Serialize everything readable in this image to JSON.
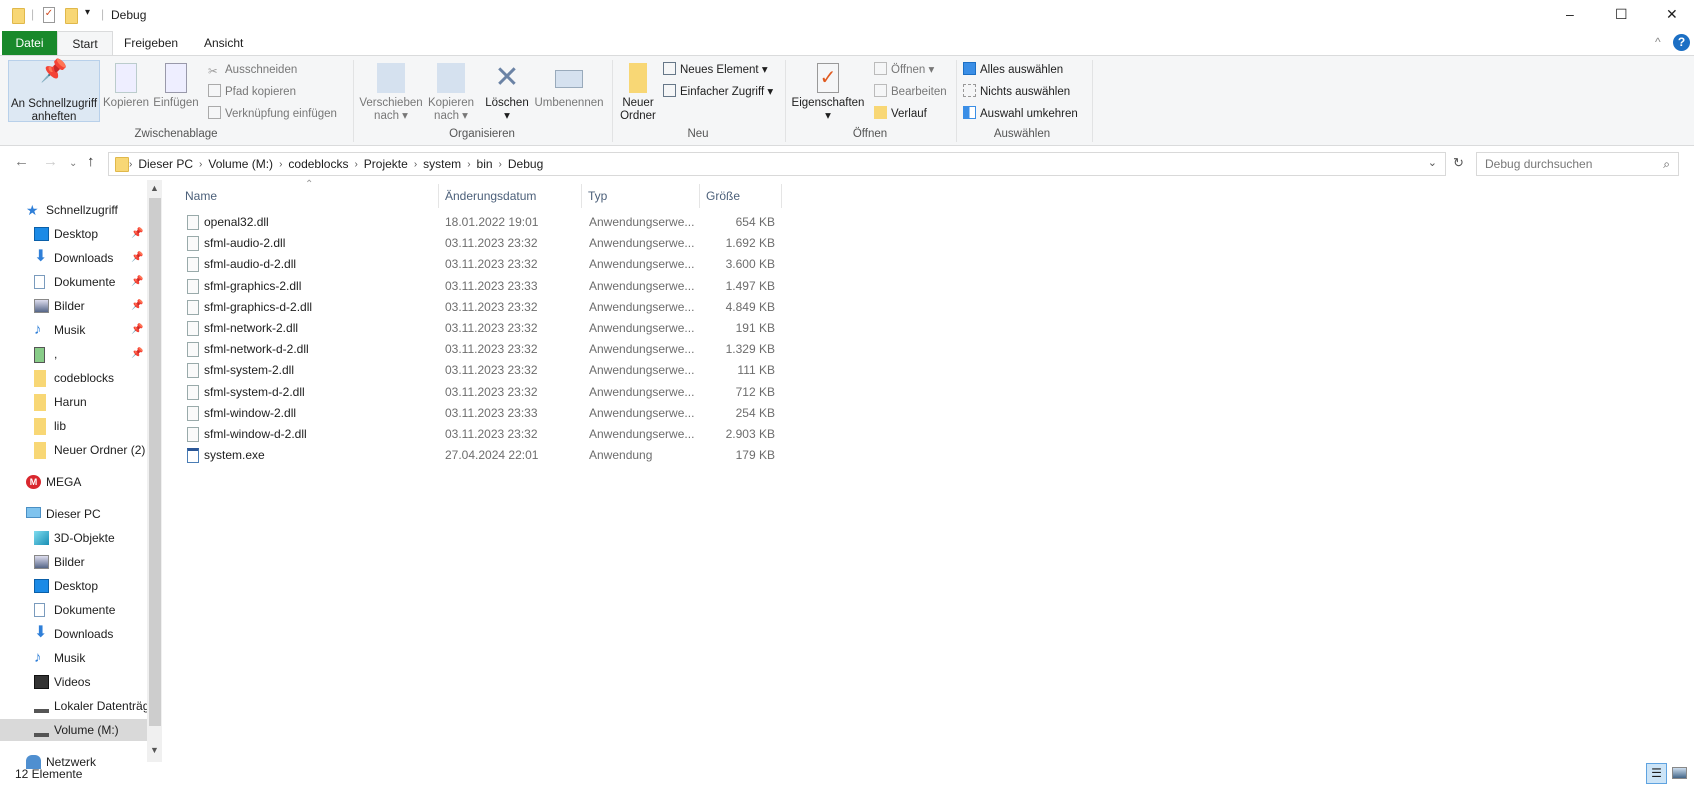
{
  "window": {
    "title": "Debug",
    "minimize": "–",
    "maximize": "☐",
    "close": "✕",
    "help": "?",
    "collapse": "^"
  },
  "tabs": [
    "Datei",
    "Start",
    "Freigeben",
    "Ansicht"
  ],
  "ribbon": {
    "pin": "An Schnellzugriff",
    "pin2": "anheften",
    "copy": "Kopieren",
    "paste": "Einfügen",
    "cut": "Ausschneiden",
    "copy_path": "Pfad kopieren",
    "paste_link": "Verknüpfung einfügen",
    "g_clipboard": "Zwischenablage",
    "move": "Verschieben",
    "move2": "nach ▾",
    "copyto": "Kopieren",
    "copyto2": "nach ▾",
    "delete": "Löschen",
    "delete2": "▾",
    "rename": "Umbenennen",
    "g_organize": "Organisieren",
    "new_folder": "Neuer",
    "new_folder2": "Ordner",
    "new_item": "Neues Element ▾",
    "easy_access": "Einfacher Zugriff ▾",
    "g_new": "Neu",
    "properties": "Eigenschaften",
    "properties2": "▾",
    "open": "Öffnen ▾",
    "edit": "Bearbeiten",
    "history": "Verlauf",
    "g_open": "Öffnen",
    "select_all": "Alles auswählen",
    "select_none": "Nichts auswählen",
    "invert": "Auswahl umkehren",
    "g_select": "Auswählen"
  },
  "address": {
    "crumbs": [
      "Dieser PC",
      "Volume (M:)",
      "codeblocks",
      "Projekte",
      "system",
      "bin",
      "Debug"
    ],
    "search_placeholder": "Debug durchsuchen"
  },
  "sidebar": [
    {
      "label": "Schnellzugriff",
      "icon": "star-icon",
      "indent": 0
    },
    {
      "label": "Desktop",
      "icon": "desktop-icon",
      "indent": 1,
      "pinned": true
    },
    {
      "label": "Downloads",
      "icon": "download-icon",
      "indent": 1,
      "pinned": true
    },
    {
      "label": "Dokumente",
      "icon": "documents-icon",
      "indent": 1,
      "pinned": true
    },
    {
      "label": "Bilder",
      "icon": "pictures-icon",
      "indent": 1,
      "pinned": true
    },
    {
      "label": "Musik",
      "icon": "music-icon",
      "indent": 1,
      "pinned": true
    },
    {
      "label": ",",
      "icon": "device-icon",
      "indent": 1,
      "pinned": true
    },
    {
      "label": "codeblocks",
      "icon": "folder-icon",
      "indent": 1
    },
    {
      "label": "Harun",
      "icon": "folder-icon",
      "indent": 1
    },
    {
      "label": "lib",
      "icon": "folder-icon",
      "indent": 1
    },
    {
      "label": "Neuer Ordner (2)",
      "icon": "folder-icon",
      "indent": 1
    },
    {
      "label": "MEGA",
      "icon": "mega-icon",
      "indent": 0,
      "gap": true
    },
    {
      "label": "Dieser PC",
      "icon": "pc-icon",
      "indent": 0,
      "gap": true
    },
    {
      "label": "3D-Objekte",
      "icon": "3d-objects-icon",
      "indent": 1
    },
    {
      "label": "Bilder",
      "icon": "pictures-icon",
      "indent": 1
    },
    {
      "label": "Desktop",
      "icon": "desktop-icon",
      "indent": 1
    },
    {
      "label": "Dokumente",
      "icon": "documents-icon",
      "indent": 1
    },
    {
      "label": "Downloads",
      "icon": "download-icon",
      "indent": 1
    },
    {
      "label": "Musik",
      "icon": "music-icon",
      "indent": 1
    },
    {
      "label": "Videos",
      "icon": "videos-icon",
      "indent": 1
    },
    {
      "label": "Lokaler Datenträg",
      "icon": "drive-icon",
      "indent": 1
    },
    {
      "label": "Volume (M:)",
      "icon": "drive-icon",
      "indent": 1,
      "selected": true
    },
    {
      "label": "Netzwerk",
      "icon": "network-icon",
      "indent": 0,
      "gap": true
    }
  ],
  "columns": [
    "Name",
    "Änderungsdatum",
    "Typ",
    "Größe"
  ],
  "files": [
    {
      "name": "openal32.dll",
      "date": "18.01.2022 19:01",
      "type": "Anwendungserwe...",
      "size": "654 KB"
    },
    {
      "name": "sfml-audio-2.dll",
      "date": "03.11.2023 23:32",
      "type": "Anwendungserwe...",
      "size": "1.692 KB"
    },
    {
      "name": "sfml-audio-d-2.dll",
      "date": "03.11.2023 23:32",
      "type": "Anwendungserwe...",
      "size": "3.600 KB"
    },
    {
      "name": "sfml-graphics-2.dll",
      "date": "03.11.2023 23:33",
      "type": "Anwendungserwe...",
      "size": "1.497 KB"
    },
    {
      "name": "sfml-graphics-d-2.dll",
      "date": "03.11.2023 23:32",
      "type": "Anwendungserwe...",
      "size": "4.849 KB"
    },
    {
      "name": "sfml-network-2.dll",
      "date": "03.11.2023 23:32",
      "type": "Anwendungserwe...",
      "size": "191 KB"
    },
    {
      "name": "sfml-network-d-2.dll",
      "date": "03.11.2023 23:32",
      "type": "Anwendungserwe...",
      "size": "1.329 KB"
    },
    {
      "name": "sfml-system-2.dll",
      "date": "03.11.2023 23:32",
      "type": "Anwendungserwe...",
      "size": "111 KB"
    },
    {
      "name": "sfml-system-d-2.dll",
      "date": "03.11.2023 23:32",
      "type": "Anwendungserwe...",
      "size": "712 KB"
    },
    {
      "name": "sfml-window-2.dll",
      "date": "03.11.2023 23:33",
      "type": "Anwendungserwe...",
      "size": "254 KB"
    },
    {
      "name": "sfml-window-d-2.dll",
      "date": "03.11.2023 23:32",
      "type": "Anwendungserwe...",
      "size": "2.903 KB"
    },
    {
      "name": "system.exe",
      "date": "27.04.2024 22:01",
      "type": "Anwendung",
      "size": "179 KB"
    }
  ],
  "status": {
    "count": "12 Elemente"
  },
  "colors": {
    "datei_tab": "#19892b",
    "accent": "#0078d7",
    "selection": "#d9d9d9"
  }
}
